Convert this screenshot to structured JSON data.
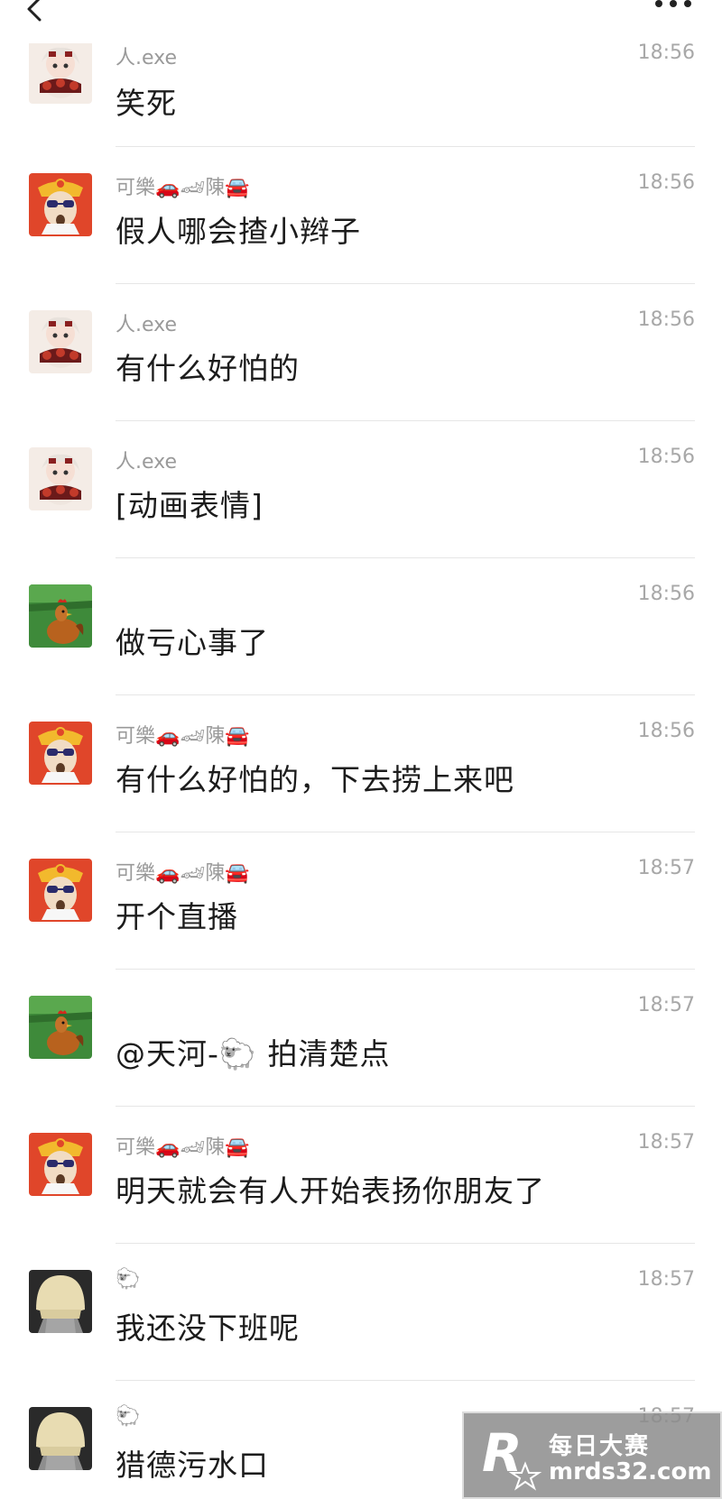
{
  "header": {
    "back_icon": "chevron-left-icon",
    "more_icon": "more-dots-icon"
  },
  "messages": [
    {
      "sender": "人.exe",
      "time": "18:56",
      "text": "笑死",
      "avatar": "anime-girl-avatar"
    },
    {
      "sender": "可樂🚗🏎陳🚘",
      "time": "18:56",
      "text": "假人哪会揸小辫子",
      "avatar": "mask-sunglasses-avatar"
    },
    {
      "sender": "人.exe",
      "time": "18:56",
      "text": "有什么好怕的",
      "avatar": "anime-girl-avatar"
    },
    {
      "sender": "人.exe",
      "time": "18:56",
      "text": "[动画表情]",
      "avatar": "anime-girl-avatar"
    },
    {
      "sender": "",
      "time": "18:56",
      "text": "做亏心事了",
      "avatar": "rooster-avatar"
    },
    {
      "sender": "可樂🚗🏎陳🚘",
      "time": "18:56",
      "text": "有什么好怕的，下去捞上来吧",
      "avatar": "mask-sunglasses-avatar"
    },
    {
      "sender": "可樂🚗🏎陳🚘",
      "time": "18:57",
      "text": "开个直播",
      "avatar": "mask-sunglasses-avatar"
    },
    {
      "sender": "",
      "time": "18:57",
      "text": "@天河-🐑 拍清楚点",
      "avatar": "rooster-avatar"
    },
    {
      "sender": "可樂🚗🏎陳🚘",
      "time": "18:57",
      "text": "明天就会有人开始表扬你朋友了",
      "avatar": "mask-sunglasses-avatar"
    },
    {
      "sender": "🐑",
      "time": "18:57",
      "text": "我还没下班呢",
      "avatar": "blonde-wig-avatar"
    },
    {
      "sender": "🐑",
      "time": "18:57",
      "text": "猎德污水口",
      "avatar": "blonde-wig-avatar"
    }
  ],
  "watermark": {
    "brand_cn": "每日大赛",
    "url": "mrds32.com",
    "logo_letter": "R"
  }
}
